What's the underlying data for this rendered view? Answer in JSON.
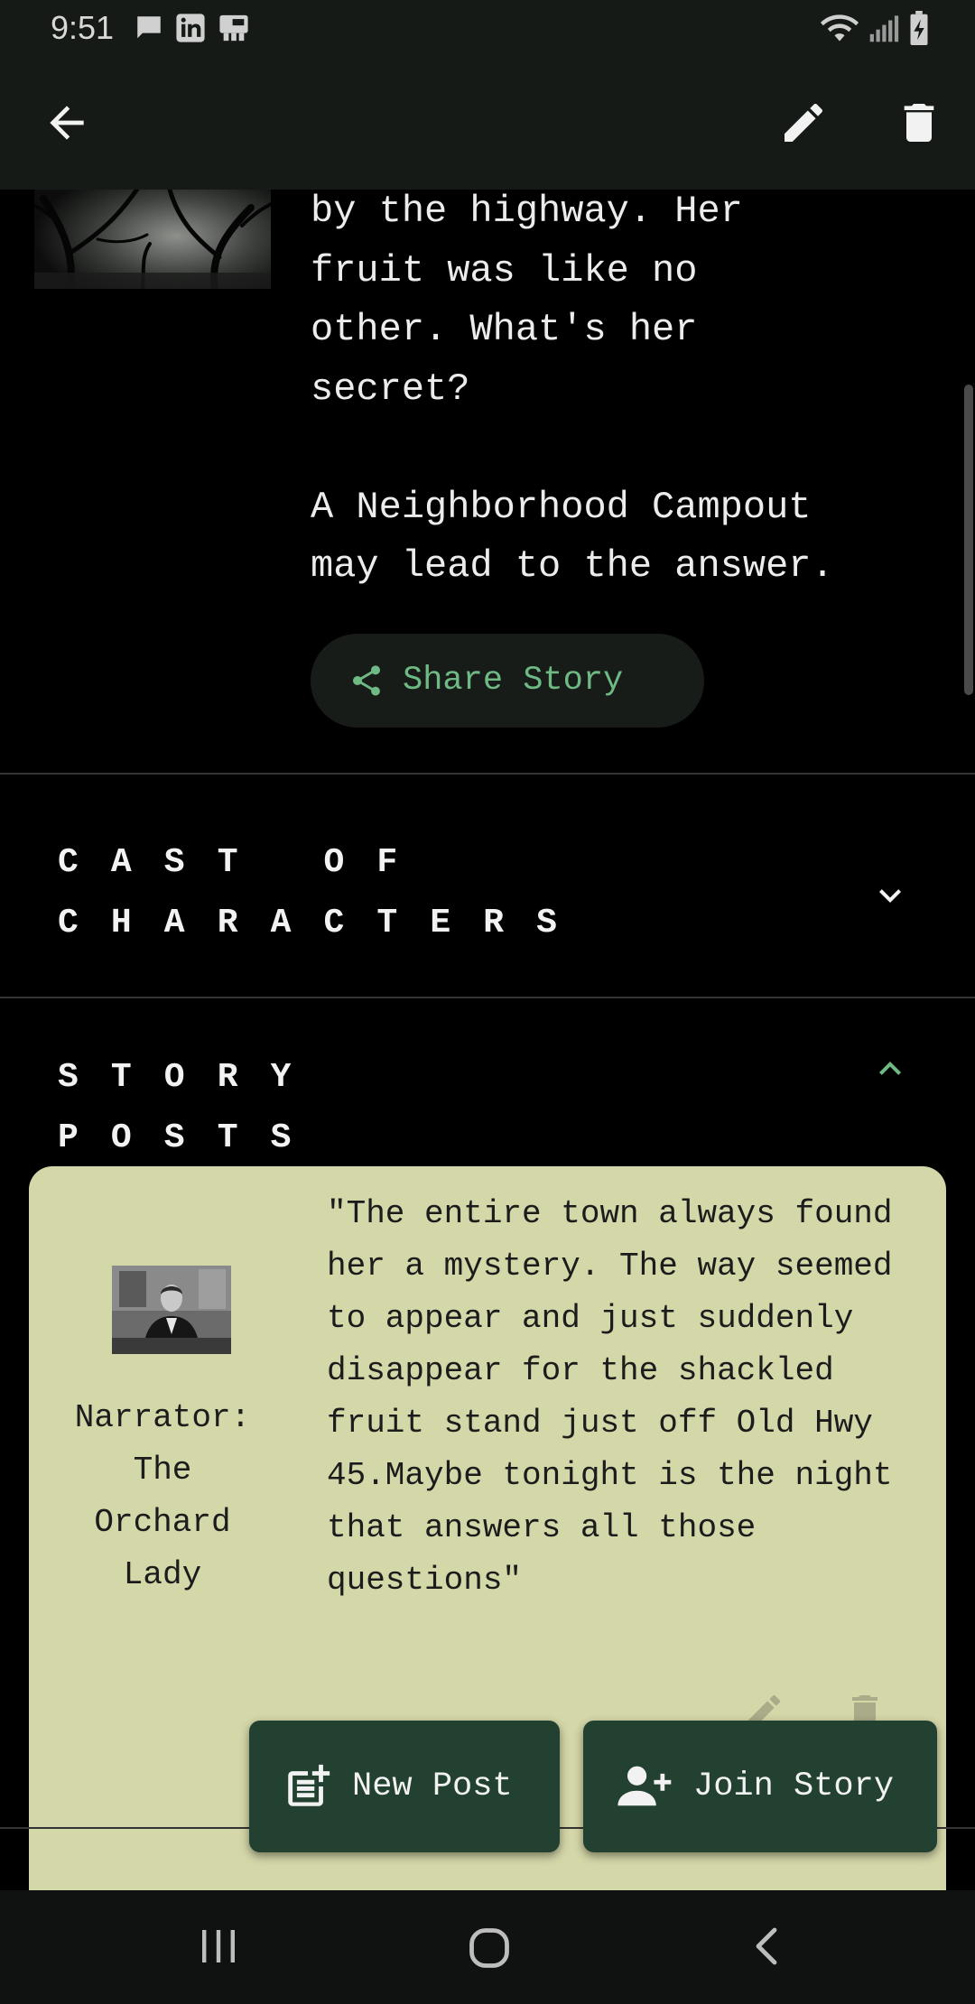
{
  "status_bar": {
    "time": "9:51",
    "notification_icons": [
      "message-icon",
      "linkedin-icon",
      "app-notification-icon"
    ],
    "right_icons": [
      "wifi-icon",
      "signal-icon",
      "battery-charging-icon"
    ]
  },
  "app_bar": {
    "back_icon": "arrow-back-icon",
    "edit_icon": "pencil-icon",
    "delete_icon": "trash-icon"
  },
  "story": {
    "description_visible": "by the highway. Her\nfruit was like no\nother. What's her\nsecret?\n\nA Neighborhood Campout\nmay lead to the answer.",
    "share_label": "Share Story"
  },
  "sections": {
    "cast": {
      "title": "CAST OF CHARACTERS",
      "expanded": false
    },
    "posts": {
      "title": "STORY POSTS",
      "expanded": true
    }
  },
  "posts": [
    {
      "author": "Narrator: The Orchard Lady",
      "text": "\"The entire town always found her a mystery. The way seemed to appear and just suddenly disappear for the shackled fruit stand just off Old Hwy 45.Maybe tonight is the night that answers all those questions\""
    }
  ],
  "actions": {
    "new_post": "New Post",
    "join_story": "Join Story"
  },
  "colors": {
    "app_bar": "#151a16",
    "accent_green": "#6fba84",
    "card_background": "#d4d7a8",
    "fab_background": "#224130"
  }
}
